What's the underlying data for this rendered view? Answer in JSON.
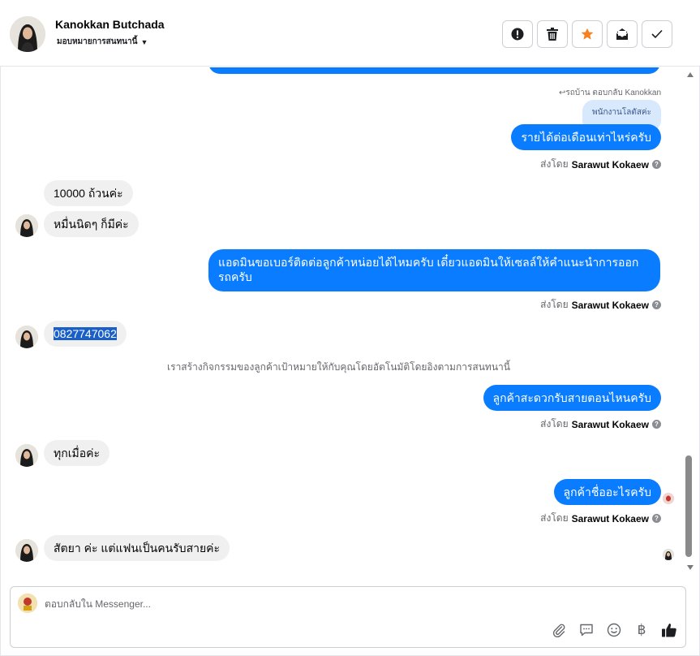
{
  "header": {
    "contact_name": "Kanokkan Butchada",
    "assign_label": "มอบหมายการสนทนานี้",
    "actions": [
      {
        "name": "report-icon"
      },
      {
        "name": "trash-icon"
      },
      {
        "name": "star-icon",
        "color": "#f5821f"
      },
      {
        "name": "mark-unread-icon"
      },
      {
        "name": "check-icon"
      }
    ]
  },
  "messages": {
    "reply_note": "↩รถบ้าน ตอบกลับ Kanokkan",
    "quoted_text": "พนักงานโลตัสค่ะ",
    "m1": "รายได้ต่อเดือนเท่าไหร่ครับ",
    "m2": "10000 ถ้วนค่ะ",
    "m3": "หมื่นนิดๆ ก็มีค่ะ",
    "m4": "แอดมินขอเบอร์ติดต่อลูกค้าหน่อยได้ไหมครับ เดี๋ยวแอดมินให้เซลล์ให้คำแนะนำการออกรถครับ",
    "m5": "0827747062",
    "system": "เราสร้างกิจกรรมของลูกค้าเป้าหมายให้กับคุณโดยอัตโนมัติโดยอิงตามการสนทนานี้",
    "m6": "ลูกค้าสะดวกรับสายตอนไหนครับ",
    "m7": "ทุกเมื่อค่ะ",
    "m8": "ลูกค้าชื่ออะไรครับ",
    "m9": "สัตยา ค่ะ แต่แฟนเป็นคนรับสายค่ะ",
    "sent_by_prefix": "ส่งโดย",
    "sent_by_name": "Sarawut Kokaew"
  },
  "composer": {
    "placeholder": "ตอบกลับใน Messenger...",
    "tools": [
      "attachment-icon",
      "saved-replies-icon",
      "emoji-icon",
      "baht-icon",
      "like-icon"
    ],
    "baht_glyph": "฿"
  },
  "colors": {
    "outgoing_bubble": "#0a7cff",
    "incoming_bubble": "#f0f0f0",
    "accent_star": "#f5821f"
  }
}
